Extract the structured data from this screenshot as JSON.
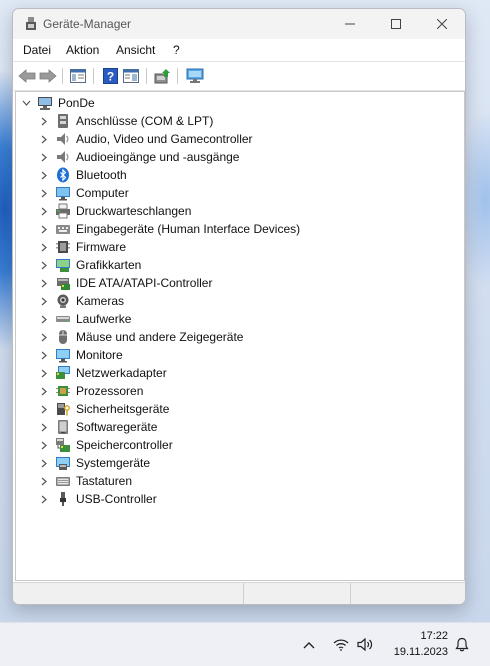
{
  "window": {
    "title": "Geräte-Manager"
  },
  "menu": [
    "Datei",
    "Aktion",
    "Ansicht",
    "?"
  ],
  "tree": {
    "root": "PonDe",
    "items": [
      {
        "label": "Anschlüsse (COM & LPT)",
        "icon": "port-icon"
      },
      {
        "label": "Audio, Video und Gamecontroller",
        "icon": "speaker-icon"
      },
      {
        "label": "Audioeingänge und -ausgänge",
        "icon": "speaker-icon"
      },
      {
        "label": "Bluetooth",
        "icon": "bluetooth-icon"
      },
      {
        "label": "Computer",
        "icon": "computer-icon"
      },
      {
        "label": "Druckwarteschlangen",
        "icon": "printer-icon"
      },
      {
        "label": "Eingabegeräte (Human Interface Devices)",
        "icon": "hid-icon"
      },
      {
        "label": "Firmware",
        "icon": "firmware-icon"
      },
      {
        "label": "Grafikkarten",
        "icon": "display-adapter-icon"
      },
      {
        "label": "IDE ATA/ATAPI-Controller",
        "icon": "ide-controller-icon"
      },
      {
        "label": "Kameras",
        "icon": "camera-icon"
      },
      {
        "label": "Laufwerke",
        "icon": "disk-drive-icon"
      },
      {
        "label": "Mäuse und andere Zeigegeräte",
        "icon": "mouse-icon"
      },
      {
        "label": "Monitore",
        "icon": "monitor-icon"
      },
      {
        "label": "Netzwerkadapter",
        "icon": "network-adapter-icon"
      },
      {
        "label": "Prozessoren",
        "icon": "processor-icon"
      },
      {
        "label": "Sicherheitsgeräte",
        "icon": "security-device-icon"
      },
      {
        "label": "Softwaregeräte",
        "icon": "software-device-icon"
      },
      {
        "label": "Speichercontroller",
        "icon": "storage-controller-icon"
      },
      {
        "label": "Systemgeräte",
        "icon": "system-device-icon"
      },
      {
        "label": "Tastaturen",
        "icon": "keyboard-icon"
      },
      {
        "label": "USB-Controller",
        "icon": "usb-icon"
      }
    ]
  },
  "taskbar": {
    "time": "17:22",
    "date": "19.11.2023"
  }
}
